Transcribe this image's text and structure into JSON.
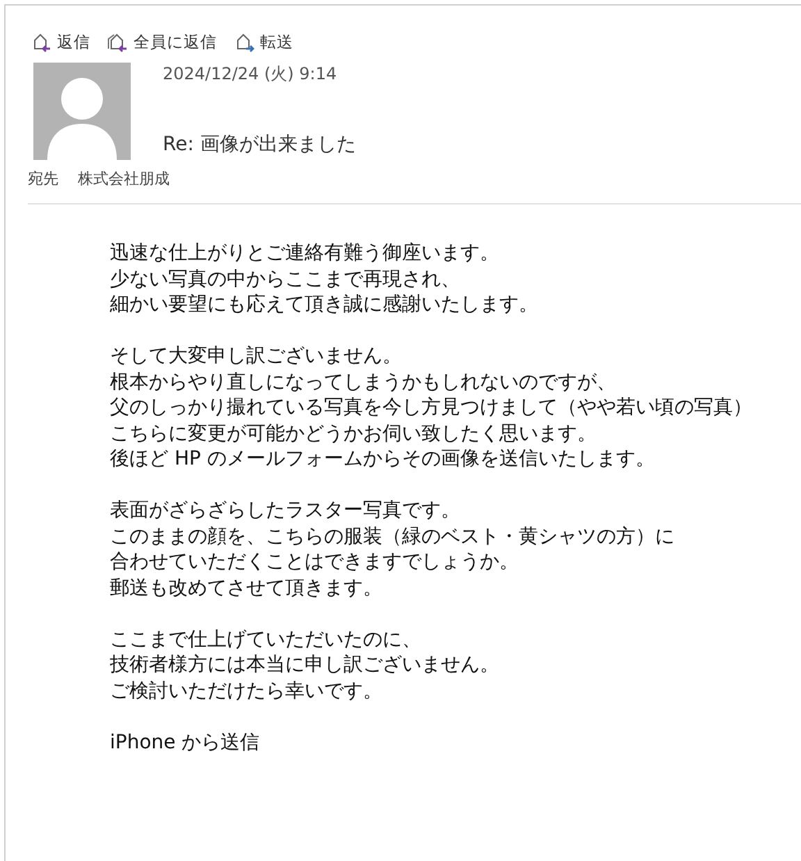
{
  "toolbar": [
    {
      "label": "返信",
      "kind": "reply"
    },
    {
      "label": "全員に返信",
      "kind": "reply_all"
    },
    {
      "label": "転送",
      "kind": "forward"
    }
  ],
  "header": {
    "date": "2024/12/24 (火) 9:14",
    "subject": "Re: 画像が出来ました",
    "to_label": "宛先",
    "to": "株式会社朋成"
  },
  "body": [
    {
      "lines": [
        "迅速な仕上がりとご連絡有難う御座います。",
        "少ない写真の中からここまで再現され、",
        "細かい要望にも応えて頂き誠に感謝いたします。"
      ]
    },
    {
      "lines": [
        "そして大変申し訳ございません。",
        "根本からやり直しになってしまうかもしれないのですが、",
        "父のしっかり撮れている写真を今し方見つけまして（やや若い頃の写真）",
        "こちらに変更が可能かどうかお伺い致したく思います。",
        "後ほど HP のメールフォームからその画像を送信いたします。"
      ]
    },
    {
      "lines": [
        "表面がざらざらしたラスター写真です。",
        "このままの顔を、こちらの服装（緑のベスト・黄シャツの方）に",
        "合わせていただくことはできますでしょうか。",
        "郵送も改めてさせて頂きます。"
      ]
    },
    {
      "lines": [
        "ここまで仕上げていただいたのに、",
        "技術者様方には本当に申し訳ございません。",
        "ご検討いただけたら幸いです。"
      ]
    },
    {
      "lines": [
        "iPhone から送信"
      ]
    }
  ]
}
